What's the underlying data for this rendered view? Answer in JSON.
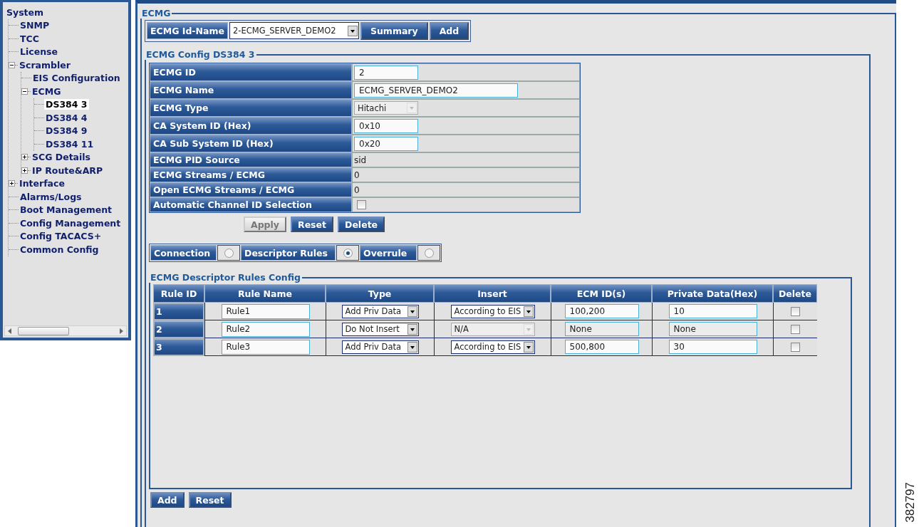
{
  "sidebar": {
    "tree": [
      {
        "label": "System",
        "selected": false,
        "children": [
          {
            "label": "SNMP",
            "selected": false
          },
          {
            "label": "TCC",
            "selected": false
          },
          {
            "label": "License",
            "selected": false
          },
          {
            "label": "Scrambler",
            "selected": false,
            "expanded": true,
            "children": [
              {
                "label": "EIS Configuration",
                "selected": false
              },
              {
                "label": "ECMG",
                "selected": false,
                "expanded": true,
                "children": [
                  {
                    "label": "DS384 3",
                    "selected": true
                  },
                  {
                    "label": "DS384 4",
                    "selected": false
                  },
                  {
                    "label": "DS384 9",
                    "selected": false
                  },
                  {
                    "label": "DS384 11",
                    "selected": false
                  }
                ]
              },
              {
                "label": "SCG Details",
                "selected": false,
                "expanded": false
              },
              {
                "label": "IP Route&ARP",
                "selected": false,
                "expanded": false
              }
            ]
          },
          {
            "label": "Interface",
            "selected": false,
            "expanded": false
          },
          {
            "label": "Alarms/Logs",
            "selected": false
          },
          {
            "label": "Boot Management",
            "selected": false
          },
          {
            "label": "Config Management",
            "selected": false
          },
          {
            "label": "Config TACACS+",
            "selected": false
          },
          {
            "label": "Common Config",
            "selected": false
          }
        ]
      }
    ]
  },
  "main": {
    "title": "ECMG",
    "id_name": {
      "label": "ECMG Id-Name",
      "value": "2-ECMG_SERVER_DEMO2",
      "buttons": [
        {
          "label": "Summary"
        },
        {
          "label": "Add"
        }
      ]
    },
    "config": {
      "title": "ECMG Config DS384 3",
      "rows": [
        {
          "label": "ECMG ID",
          "kind": "input",
          "value": "2"
        },
        {
          "label": "ECMG Name",
          "kind": "input",
          "value": "ECMG_SERVER_DEMO2"
        },
        {
          "label": "ECMG Type",
          "kind": "select",
          "value": "Hitachi"
        },
        {
          "label": "CA System ID (Hex)",
          "kind": "input",
          "value": "0x10"
        },
        {
          "label": "CA Sub System ID (Hex)",
          "kind": "input",
          "value": "0x20"
        },
        {
          "label": "ECMG PID Source",
          "kind": "text",
          "value": "sid"
        },
        {
          "label": "ECMG Streams / ECMG",
          "kind": "text",
          "value": "0"
        },
        {
          "label": "Open ECMG Streams / ECMG",
          "kind": "text",
          "value": "0"
        },
        {
          "label": "Automatic Channel ID Selection",
          "kind": "checkbox",
          "checked": false
        }
      ],
      "buttons": [
        {
          "label": "Apply",
          "disabled": true
        },
        {
          "label": "Reset",
          "disabled": false
        },
        {
          "label": "Delete",
          "disabled": false
        }
      ]
    },
    "tabs": [
      {
        "label": "Connection",
        "selected": false
      },
      {
        "label": "Descriptor Rules",
        "selected": true
      },
      {
        "label": "Overrule",
        "selected": false
      }
    ],
    "rules": {
      "title": "ECMG Descriptor Rules Config",
      "columns": [
        "Rule ID",
        "Rule Name",
        "Type",
        "Insert",
        "ECM ID(s)",
        "Private Data(Hex)",
        "Delete"
      ],
      "rows": [
        {
          "id": "1",
          "name": "Rule1",
          "type": "Add Priv Data",
          "insert": {
            "value": "According to EIS",
            "disabled": false
          },
          "ecm_ids": {
            "value": "100,200",
            "disabled": false
          },
          "private_data": {
            "value": "10",
            "disabled": false
          },
          "delete": false
        },
        {
          "id": "2",
          "name": "Rule2",
          "type": "Do Not Insert",
          "insert": {
            "value": "N/A",
            "disabled": true
          },
          "ecm_ids": {
            "value": "None",
            "disabled": true
          },
          "private_data": {
            "value": "None",
            "disabled": true
          },
          "delete": false
        },
        {
          "id": "3",
          "name": "Rule3",
          "type": "Add Priv Data",
          "insert": {
            "value": "According to EIS",
            "disabled": false
          },
          "ecm_ids": {
            "value": "500,800",
            "disabled": false
          },
          "private_data": {
            "value": "30",
            "disabled": false
          },
          "delete": false
        }
      ]
    },
    "buttons": [
      {
        "label": "Add"
      },
      {
        "label": "Reset"
      }
    ]
  },
  "figure_number": "382797"
}
